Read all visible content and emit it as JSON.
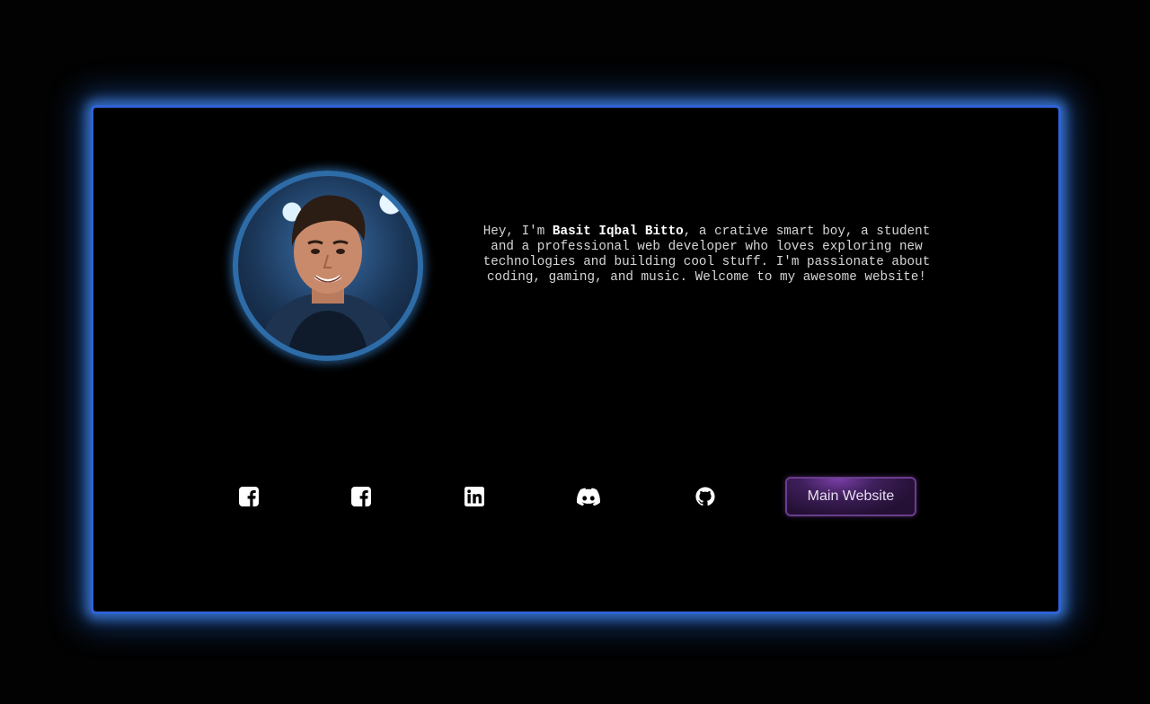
{
  "bio": {
    "prefix": "Hey, I'm ",
    "name": "Basit Iqbal Bitto",
    "suffix": ", a crative smart boy, a student and a professional web developer who loves exploring new technologies and building cool stuff. I'm passionate about coding, gaming, and music. Welcome to my awesome website!"
  },
  "social_links": [
    {
      "icon": "facebook-square-icon"
    },
    {
      "icon": "facebook-square-icon"
    },
    {
      "icon": "linkedin-icon"
    },
    {
      "icon": "discord-icon"
    },
    {
      "icon": "github-icon"
    }
  ],
  "main_button": {
    "label": "Main Website"
  },
  "colors": {
    "card_border": "#2f63d6",
    "glow": "#4282e6",
    "avatar_ring": "#2e6ca8",
    "button_fill": "#3e1f5a",
    "button_border": "#6a3d8c",
    "text": "#d6d6d6"
  }
}
